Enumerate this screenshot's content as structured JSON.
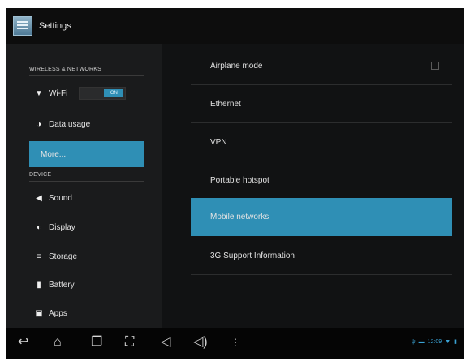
{
  "titlebar": {
    "title": "Settings",
    "icon": "settings-icon"
  },
  "sidebar": {
    "sections": [
      {
        "header": "WIRELESS & NETWORKS",
        "items": [
          {
            "label": "Wi-Fi",
            "icon": "wifi-icon",
            "toggle": "ON"
          },
          {
            "label": "Data usage",
            "icon": "data-usage-icon"
          },
          {
            "label": "More...",
            "selected": true
          }
        ]
      },
      {
        "header": "DEVICE",
        "items": [
          {
            "label": "Sound",
            "icon": "speaker-icon"
          },
          {
            "label": "Display",
            "icon": "display-icon"
          },
          {
            "label": "Storage",
            "icon": "storage-icon"
          },
          {
            "label": "Battery",
            "icon": "battery-icon"
          },
          {
            "label": "Apps",
            "icon": "apps-icon"
          }
        ]
      }
    ]
  },
  "content": {
    "items": [
      {
        "label": "Airplane mode",
        "checkbox": true
      },
      {
        "label": "Ethernet"
      },
      {
        "label": "VPN"
      },
      {
        "label": "Portable hotspot"
      },
      {
        "label": "Mobile networks",
        "selected": true
      },
      {
        "label": "3G Support Information"
      }
    ]
  },
  "navbar": {
    "buttons": [
      "back-icon",
      "home-icon",
      "recent-apps-icon",
      "screenshot-icon",
      "volume-down-icon",
      "volume-up-icon",
      "menu-icon"
    ],
    "status": {
      "time": "12:09",
      "icons": [
        "usb-icon",
        "wifi-icon",
        "battery-icon"
      ]
    }
  },
  "colors": {
    "accent": "#2f8fb5",
    "background": "#111213",
    "sidebar": "#1a1b1c"
  }
}
